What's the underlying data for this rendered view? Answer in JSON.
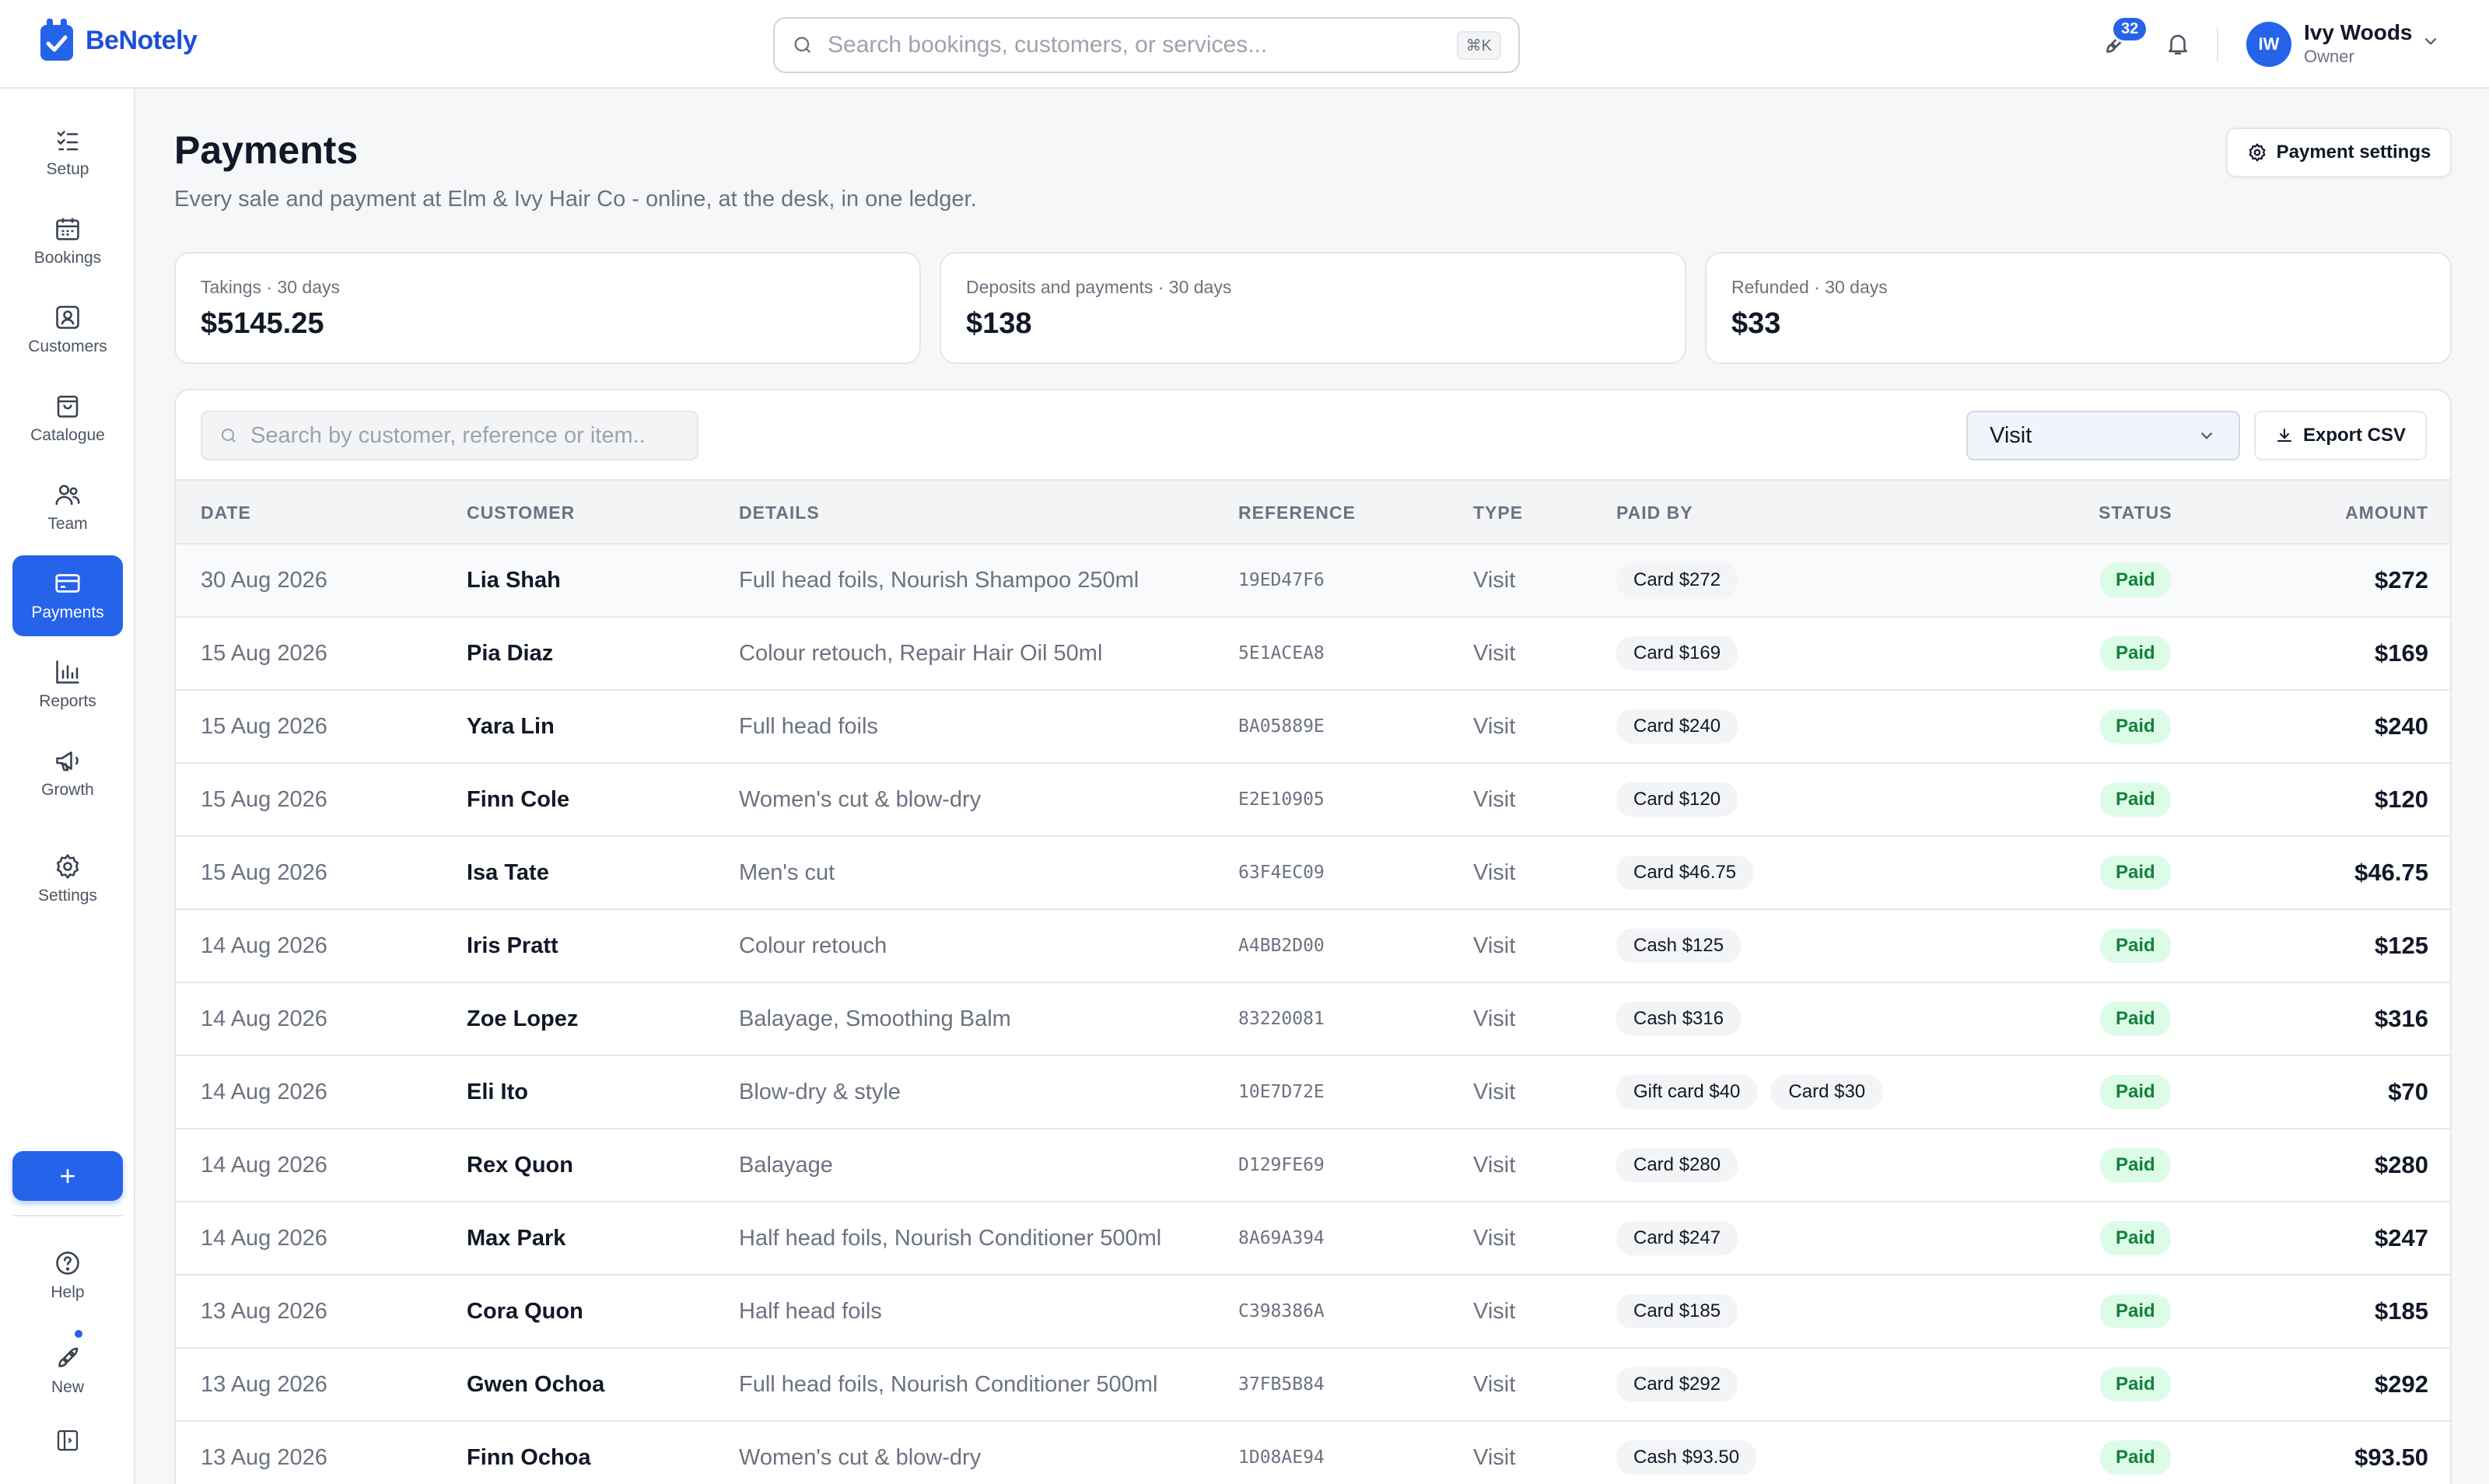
{
  "app": {
    "name": "BeNotely"
  },
  "header": {
    "search_placeholder": "Search bookings, customers, or services...",
    "shortcut": "⌘K",
    "notification_count": "32",
    "user": {
      "initials": "IW",
      "name": "Ivy Woods",
      "role": "Owner"
    }
  },
  "sidebar": {
    "items": [
      {
        "label": "Setup",
        "icon": "checklist-icon"
      },
      {
        "label": "Bookings",
        "icon": "calendar-icon"
      },
      {
        "label": "Customers",
        "icon": "contact-card-icon"
      },
      {
        "label": "Catalogue",
        "icon": "shopping-bag-icon"
      },
      {
        "label": "Team",
        "icon": "team-icon"
      },
      {
        "label": "Payments",
        "icon": "credit-card-icon",
        "active": true
      },
      {
        "label": "Reports",
        "icon": "bar-chart-icon"
      },
      {
        "label": "Growth",
        "icon": "megaphone-icon"
      },
      {
        "label": "Settings",
        "icon": "gear-icon"
      }
    ],
    "add_label": "+",
    "bottom": [
      {
        "label": "Help",
        "icon": "help-icon"
      },
      {
        "label": "New",
        "icon": "rocket-icon"
      }
    ]
  },
  "page": {
    "title": "Payments",
    "subtitle": "Every sale and payment at Elm & Ivy Hair Co - online, at the desk, in one ledger.",
    "settings_button": "Payment settings"
  },
  "stats": [
    {
      "label": "Takings · 30 days",
      "value": "$5145.25"
    },
    {
      "label": "Deposits and payments · 30 days",
      "value": "$138"
    },
    {
      "label": "Refunded · 30 days",
      "value": "$33"
    }
  ],
  "table": {
    "search_placeholder": "Search by customer, reference or item..",
    "filter_value": "Visit",
    "export_label": "Export CSV",
    "columns": [
      "DATE",
      "CUSTOMER",
      "DETAILS",
      "REFERENCE",
      "TYPE",
      "PAID BY",
      "STATUS",
      "AMOUNT"
    ],
    "rows": [
      {
        "date": "30 Aug 2026",
        "customer": "Lia Shah",
        "details": "Full head foils, Nourish Shampoo 250ml",
        "reference": "19ED47F6",
        "type": "Visit",
        "paid_by": [
          "Card $272"
        ],
        "status": "Paid",
        "amount": "$272"
      },
      {
        "date": "15 Aug 2026",
        "customer": "Pia Diaz",
        "details": "Colour retouch, Repair Hair Oil 50ml",
        "reference": "5E1ACEA8",
        "type": "Visit",
        "paid_by": [
          "Card $169"
        ],
        "status": "Paid",
        "amount": "$169"
      },
      {
        "date": "15 Aug 2026",
        "customer": "Yara Lin",
        "details": "Full head foils",
        "reference": "BA05889E",
        "type": "Visit",
        "paid_by": [
          "Card $240"
        ],
        "status": "Paid",
        "amount": "$240"
      },
      {
        "date": "15 Aug 2026",
        "customer": "Finn Cole",
        "details": "Women's cut & blow-dry",
        "reference": "E2E10905",
        "type": "Visit",
        "paid_by": [
          "Card $120"
        ],
        "status": "Paid",
        "amount": "$120"
      },
      {
        "date": "15 Aug 2026",
        "customer": "Isa Tate",
        "details": "Men's cut",
        "reference": "63F4EC09",
        "type": "Visit",
        "paid_by": [
          "Card $46.75"
        ],
        "status": "Paid",
        "amount": "$46.75"
      },
      {
        "date": "14 Aug 2026",
        "customer": "Iris Pratt",
        "details": "Colour retouch",
        "reference": "A4BB2D00",
        "type": "Visit",
        "paid_by": [
          "Cash $125"
        ],
        "status": "Paid",
        "amount": "$125"
      },
      {
        "date": "14 Aug 2026",
        "customer": "Zoe Lopez",
        "details": "Balayage, Smoothing Balm",
        "reference": "83220081",
        "type": "Visit",
        "paid_by": [
          "Cash $316"
        ],
        "status": "Paid",
        "amount": "$316"
      },
      {
        "date": "14 Aug 2026",
        "customer": "Eli Ito",
        "details": "Blow-dry & style",
        "reference": "10E7D72E",
        "type": "Visit",
        "paid_by": [
          "Gift card $40",
          "Card $30"
        ],
        "status": "Paid",
        "amount": "$70"
      },
      {
        "date": "14 Aug 2026",
        "customer": "Rex Quon",
        "details": "Balayage",
        "reference": "D129FE69",
        "type": "Visit",
        "paid_by": [
          "Card $280"
        ],
        "status": "Paid",
        "amount": "$280"
      },
      {
        "date": "14 Aug 2026",
        "customer": "Max Park",
        "details": "Half head foils, Nourish Conditioner 500ml",
        "reference": "8A69A394",
        "type": "Visit",
        "paid_by": [
          "Card $247"
        ],
        "status": "Paid",
        "amount": "$247"
      },
      {
        "date": "13 Aug 2026",
        "customer": "Cora Quon",
        "details": "Half head foils",
        "reference": "C398386A",
        "type": "Visit",
        "paid_by": [
          "Card $185"
        ],
        "status": "Paid",
        "amount": "$185"
      },
      {
        "date": "13 Aug 2026",
        "customer": "Gwen Ochoa",
        "details": "Full head foils, Nourish Conditioner 500ml",
        "reference": "37FB5B84",
        "type": "Visit",
        "paid_by": [
          "Card $292"
        ],
        "status": "Paid",
        "amount": "$292"
      },
      {
        "date": "13 Aug 2026",
        "customer": "Finn Ochoa",
        "details": "Women's cut & blow-dry",
        "reference": "1D08AE94",
        "type": "Visit",
        "paid_by": [
          "Cash $93.50"
        ],
        "status": "Paid",
        "amount": "$93.50"
      }
    ]
  }
}
